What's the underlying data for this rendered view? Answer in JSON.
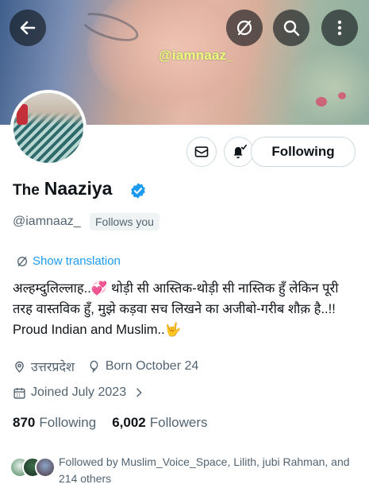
{
  "banner": {
    "watermark": "@iamnaaz_"
  },
  "profile": {
    "name_prefix": "The",
    "name": "Naaziya",
    "handle": "@iamnaaz_",
    "follows_you": "Follows you",
    "follow_button": "Following"
  },
  "translation": {
    "label": "Show translation"
  },
  "bio": {
    "line1": "अल्हम्दुलिल्लाह..💞 थोड़ी सी आस्तिक-थोड़ी सी नास्तिक हुँ लेकिन पूरी तरह वास्तविक हुँ, मुझे कड़वा सच लिखने का अजीबो-गरीब शौक़ है..!!  Proud Indian and Muslim..🤟"
  },
  "meta": {
    "location": "उत्तरप्रदेश",
    "birthday": "Born October 24",
    "joined": "Joined July 2023"
  },
  "stats": {
    "following_count": "870",
    "following_label": "Following",
    "followers_count": "6,002",
    "followers_label": "Followers"
  },
  "followed_by": {
    "text": "Followed by Muslim_Voice_Space, Lilith, jubi Rahman, and 214 others"
  },
  "icons": {
    "back": "arrow-left-icon",
    "translate_off": "translate-off-icon",
    "search": "search-icon",
    "more": "more-vertical-icon",
    "message": "envelope-icon",
    "notify": "bell-check-icon",
    "verified": "verified-badge-icon",
    "location": "location-pin-icon",
    "birthday": "balloon-icon",
    "calendar": "calendar-icon"
  },
  "colors": {
    "accent": "#1d9bf0",
    "text": "#0f1419",
    "secondary": "#536471"
  }
}
